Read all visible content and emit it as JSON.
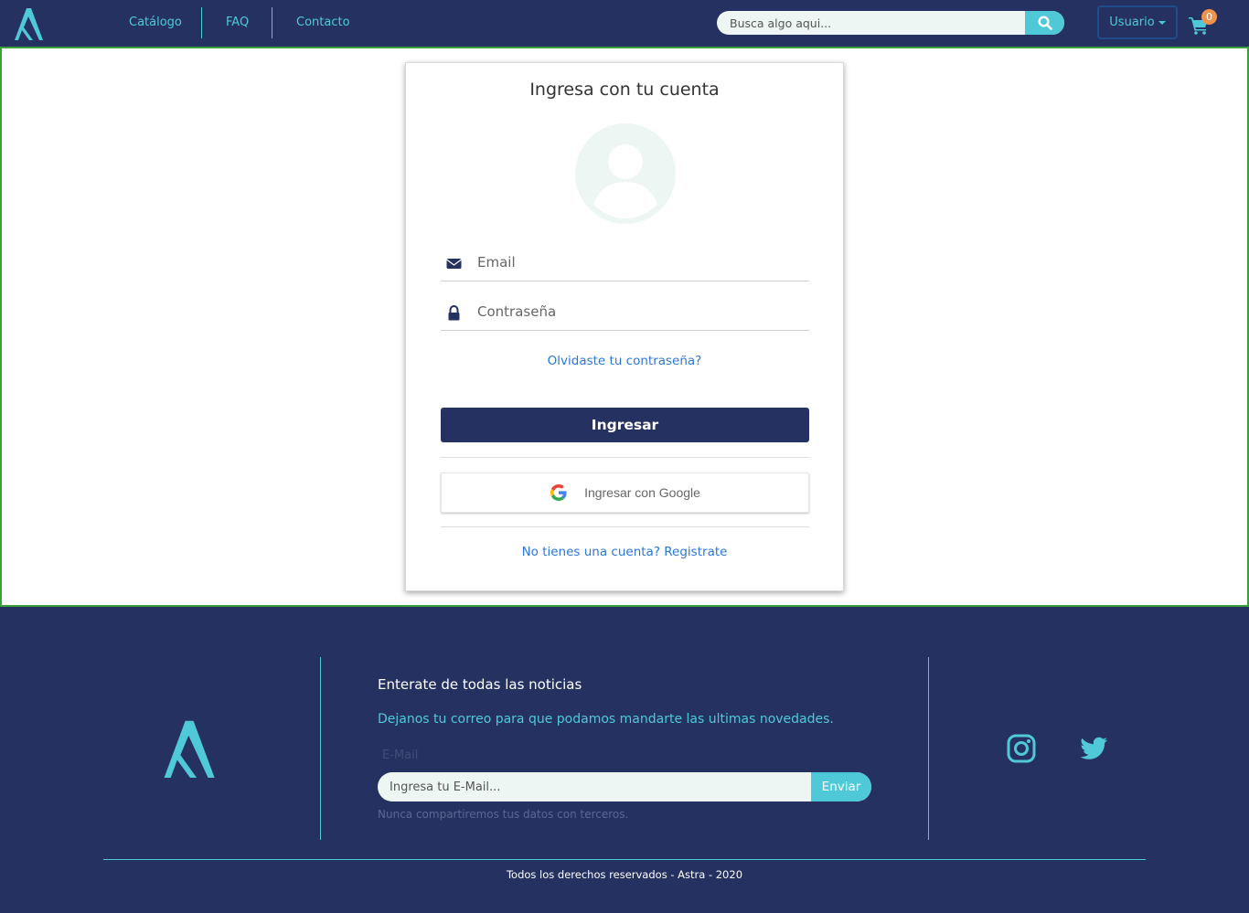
{
  "nav": {
    "links": [
      "Catálogo",
      "FAQ",
      "Contacto"
    ],
    "search_placeholder": "Busca algo aqui...",
    "user_label": "Usuario",
    "cart_count": "0"
  },
  "login": {
    "title": "Ingresa con tu cuenta",
    "email_placeholder": "Email",
    "password_placeholder": "Contraseña",
    "forgot_link": "Olvidaste tu contraseña?",
    "submit_label": "Ingresar",
    "google_label": "Ingresar con Google",
    "register_link": "No tienes una cuenta? Registrate"
  },
  "footer": {
    "newsletter_title": "Enterate de todas las noticias",
    "newsletter_desc": "Dejanos tu correo para que podamos mandarte las ultimas novedades.",
    "email_label": "E-Mail",
    "email_placeholder": "Ingresa tu E-Mail...",
    "send_label": "Enviar",
    "help_text": "Nunca compartiremos tus datos con terceros.",
    "copyright": "Todos los derechos reservados - Astra - 2020"
  },
  "colors": {
    "navy": "#253261",
    "accent": "#4fc9d8",
    "link": "#2a77d6",
    "badge": "#f0924a",
    "frame": "#3aa13a"
  },
  "icons": [
    "astra-logo",
    "search-icon",
    "cart-icon",
    "user-avatar-icon",
    "envelope-icon",
    "lock-icon",
    "google-icon",
    "instagram-icon",
    "twitter-icon"
  ]
}
